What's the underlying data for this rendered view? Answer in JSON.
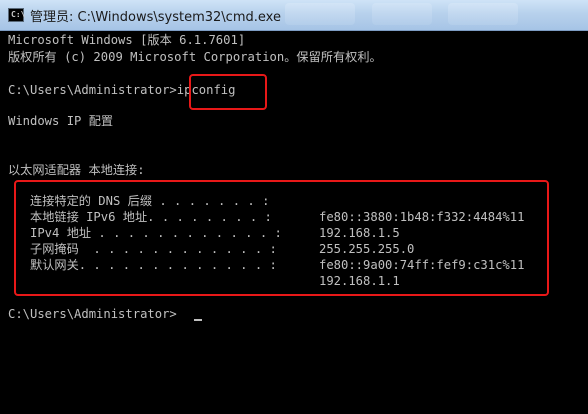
{
  "window": {
    "title": "管理员: C:\\Windows\\system32\\cmd.exe",
    "icon_text": "C:\\"
  },
  "console": {
    "version_line": "Microsoft Windows [版本 6.1.7601]",
    "copyright_line": "版权所有 (c) 2009 Microsoft Corporation。保留所有权利。",
    "prompt": "C:\\Users\\Administrator>",
    "command": "ipconfig",
    "ip_config_title": "Windows IP 配置",
    "adapter_header": "以太网适配器 本地连接:",
    "entries": [
      {
        "label": "   连接特定的 DNS 后缀 . . . . . . . :",
        "value": ""
      },
      {
        "label": "   本地链接 IPv6 地址. . . . . . . . :",
        "value": "fe80::3880:1b48:f332:4484%11"
      },
      {
        "label": "   IPv4 地址 . . . . . . . . . . . . :",
        "value": "192.168.1.5"
      },
      {
        "label": "   子网掩码  . . . . . . . . . . . . :",
        "value": "255.255.255.0"
      },
      {
        "label": "   默认网关. . . . . . . . . . . . . :",
        "value": "fe80::9a00:74ff:fef9:c31c%11"
      }
    ],
    "gateway_ipv4": "192.168.1.1",
    "final_prompt": "C:\\Users\\Administrator>"
  }
}
